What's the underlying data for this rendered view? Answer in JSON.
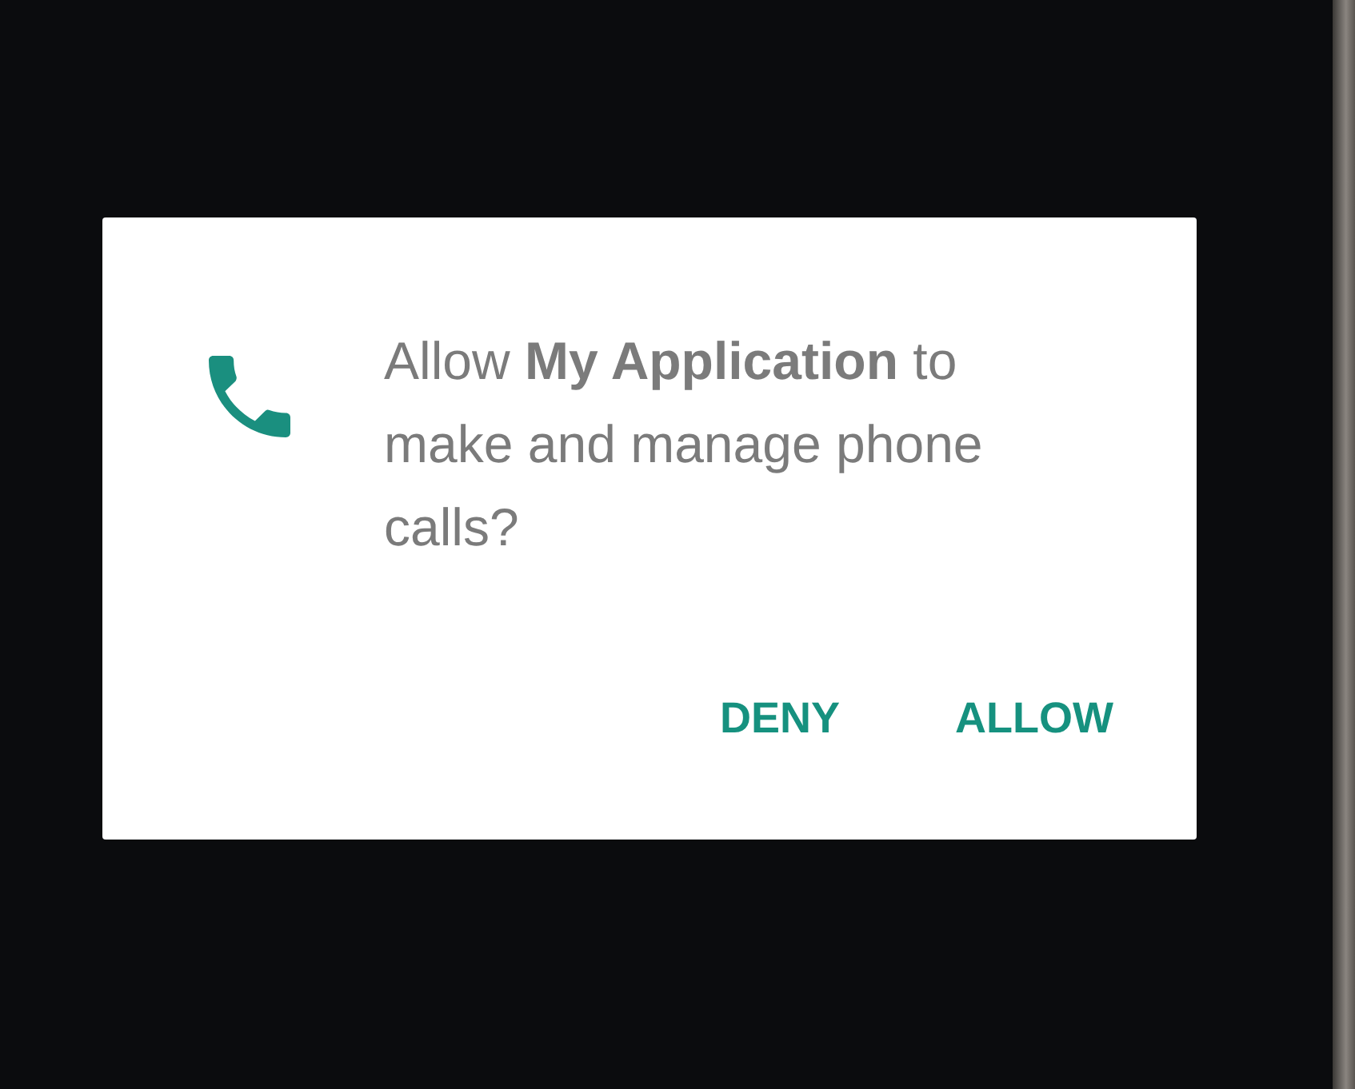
{
  "dialog": {
    "message": "Allow **My Application** to make and manage phone calls?",
    "buttons": [
      "DENY",
      "ALLOW"
    ]
  }
}
